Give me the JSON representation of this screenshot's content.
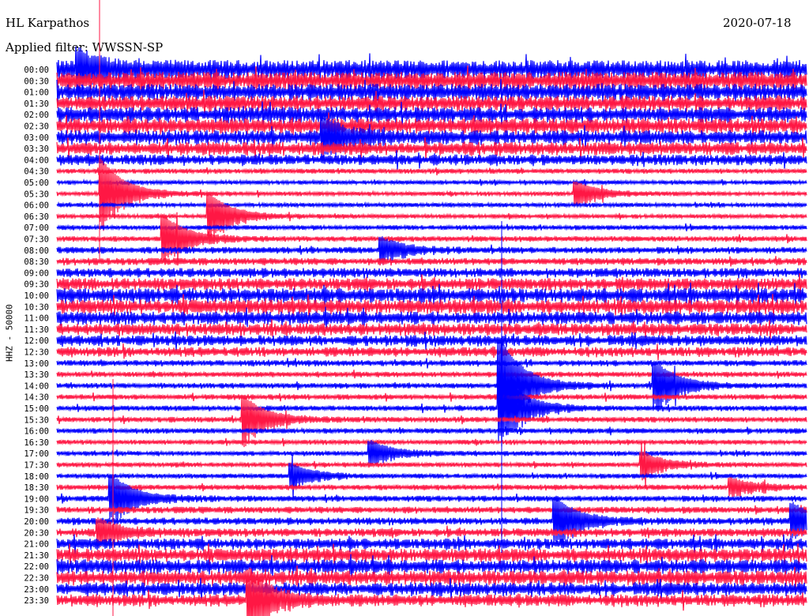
{
  "header": {
    "station": "HL Karpathos",
    "date": "2020-07-18",
    "filter": "Applied filter: WWSSN-SP"
  },
  "chart_data": {
    "type": "line",
    "title": "HL Karpathos",
    "ylabel": "HHZ - 50000",
    "xlabel": "",
    "row_minutes": 30,
    "colors": [
      "#0000ff",
      "#ff1744"
    ],
    "rows": [
      "00:00",
      "00:30",
      "01:00",
      "01:30",
      "02:00",
      "02:30",
      "03:00",
      "03:30",
      "04:00",
      "04:30",
      "05:00",
      "05:30",
      "06:00",
      "06:30",
      "07:00",
      "07:30",
      "08:00",
      "08:30",
      "09:00",
      "09:30",
      "10:00",
      "10:30",
      "11:00",
      "11:30",
      "12:00",
      "12:30",
      "13:00",
      "13:30",
      "14:00",
      "14:30",
      "15:00",
      "15:30",
      "16:00",
      "16:30",
      "17:00",
      "17:30",
      "18:00",
      "18:30",
      "19:00",
      "19:30",
      "20:00",
      "20:30",
      "21:00",
      "21:30",
      "22:00",
      "22:30",
      "23:00",
      "23:30"
    ],
    "noise_level": [
      1.6,
      1.5,
      1.4,
      1.3,
      1.3,
      1.3,
      1.2,
      1.1,
      0.9,
      0.4,
      0.35,
      0.35,
      0.35,
      0.35,
      0.4,
      0.45,
      0.55,
      0.6,
      0.8,
      1.0,
      1.2,
      1.2,
      1.1,
      1.0,
      0.9,
      0.8,
      0.5,
      0.45,
      0.45,
      0.45,
      0.45,
      0.45,
      0.45,
      0.4,
      0.4,
      0.4,
      0.4,
      0.45,
      0.5,
      0.55,
      0.6,
      0.7,
      0.9,
      1.1,
      1.2,
      1.2,
      1.1,
      1.0
    ],
    "events": [
      {
        "row": 0,
        "minute": 0.9,
        "amp": 2.5
      },
      {
        "row": 6,
        "minute": 10.7,
        "amp": 3
      },
      {
        "row": 11,
        "minute": 1.8,
        "amp": 6
      },
      {
        "row": 13,
        "minute": 6.1,
        "amp": 4
      },
      {
        "row": 15,
        "minute": 4.3,
        "amp": 4
      },
      {
        "row": 11,
        "minute": 20.8,
        "amp": 2
      },
      {
        "row": 16,
        "minute": 13,
        "amp": 2
      },
      {
        "row": 28,
        "minute": 17.8,
        "amp": 8
      },
      {
        "row": 30,
        "minute": 17.8,
        "amp": 6
      },
      {
        "row": 28,
        "minute": 24,
        "amp": 4
      },
      {
        "row": 31,
        "minute": 7.5,
        "amp": 4
      },
      {
        "row": 34,
        "minute": 12.6,
        "amp": 2
      },
      {
        "row": 35,
        "minute": 23.5,
        "amp": 2
      },
      {
        "row": 36,
        "minute": 9.4,
        "amp": 2
      },
      {
        "row": 37,
        "minute": 27,
        "amp": 1.5
      },
      {
        "row": 38,
        "minute": 2.2,
        "amp": 4
      },
      {
        "row": 40,
        "minute": 20,
        "amp": 4
      },
      {
        "row": 40,
        "minute": 29.5,
        "amp": 3
      },
      {
        "row": 41,
        "minute": 1.7,
        "amp": 2
      },
      {
        "row": 47,
        "minute": 7.7,
        "amp": 5
      }
    ]
  }
}
